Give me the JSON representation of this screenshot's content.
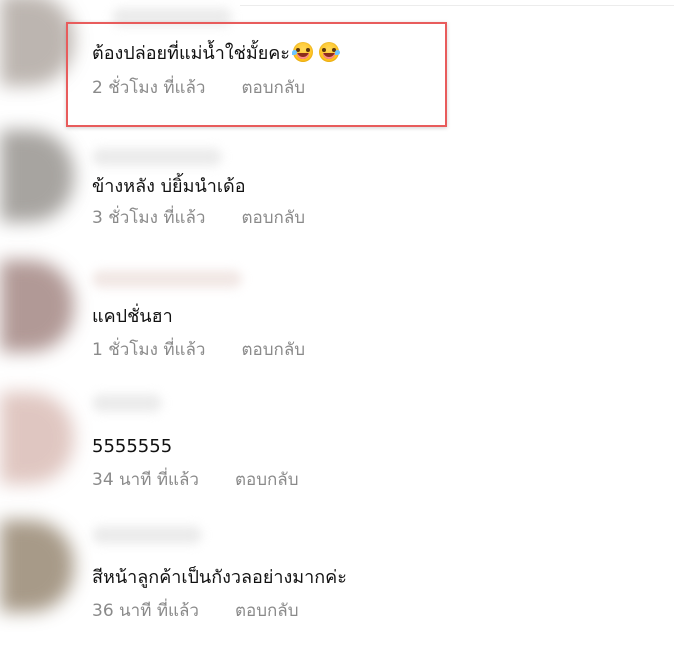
{
  "comments": [
    {
      "text": "ต้องปล่อยที่แม่น้ำใช่มั้ยคะ",
      "emojis": [
        "grinning-squinting-face-icon",
        "grinning-squinting-face-icon"
      ],
      "time": "2 ชั่วโมง ที่แล้ว",
      "reply": "ตอบกลับ",
      "avatar_color": "#aaa19a",
      "selected": true
    },
    {
      "text": "ข้างหลัง บ่ยิ้มนำเด้อ",
      "time": "3 ชั่วโมง ที่แล้ว",
      "reply": "ตอบกลับ",
      "avatar_color": "#8f8b86",
      "selected": false
    },
    {
      "text": "แคปชั่นฮา",
      "time": "1 ชั่วโมง ที่แล้ว",
      "reply": "ตอบกลับ",
      "avatar_color": "#9c7d79",
      "selected": false
    },
    {
      "text": "5555555",
      "time": "34 นาที ที่แล้ว",
      "reply": "ตอบกลับ",
      "avatar_color": "#d7b7b0",
      "selected": false
    },
    {
      "text": "สีหน้าลูกค้าเป็นกังวลอย่างมากค่ะ",
      "time": "36 นาที ที่แล้ว",
      "reply": "ตอบกลับ",
      "avatar_color": "#8f7e67",
      "selected": false
    }
  ]
}
